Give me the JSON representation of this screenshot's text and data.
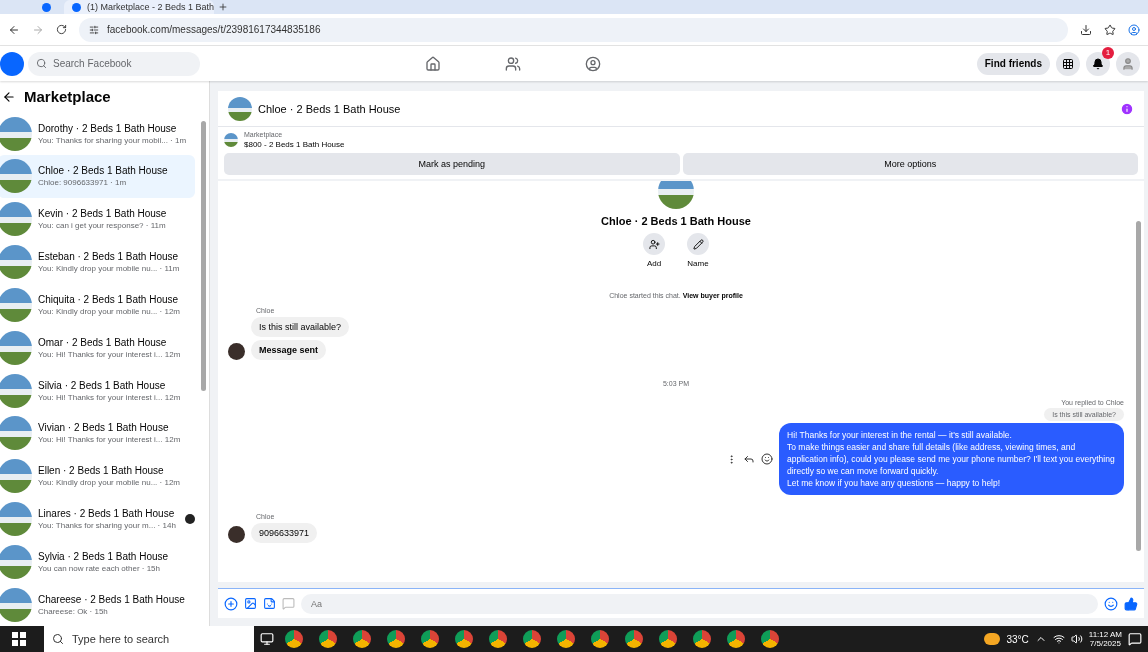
{
  "browser": {
    "tabs": [
      {
        "kind": "pinned",
        "selected": false
      },
      {
        "kind": "page",
        "title": "(1) Marketplace - 2 Beds 1 Bath",
        "selected": true
      }
    ],
    "url": "facebook.com/messages/t/23981617344835186"
  },
  "header": {
    "search_placeholder": "Search Facebook",
    "find_friends": "Find friends",
    "notification_count": "1"
  },
  "sidebar": {
    "title": "Marketplace",
    "conversations": [
      {
        "name": "Dorothy · 2 Beds 1 Bath House",
        "preview": "You: Thanks for sharing your mobil... · 1m",
        "selected": false,
        "seen": false
      },
      {
        "name": "Chloe · 2 Beds 1 Bath House",
        "preview": "Chloe: 9096633971 · 1m",
        "selected": true,
        "seen": false
      },
      {
        "name": "Kevin · 2 Beds 1 Bath House",
        "preview": "You: can i get your response? · 11m",
        "selected": false,
        "seen": false
      },
      {
        "name": "Esteban · 2 Beds 1 Bath House",
        "preview": "You: Kindly drop your mobile nu...  · 11m",
        "selected": false,
        "seen": false
      },
      {
        "name": "Chiquita · 2 Beds 1 Bath House",
        "preview": "You: Kindly drop your mobile nu...  · 12m",
        "selected": false,
        "seen": false
      },
      {
        "name": "Omar · 2 Beds 1 Bath House",
        "preview": "You: Hi! Thanks for your interest i...  12m",
        "selected": false,
        "seen": false
      },
      {
        "name": "Silvia · 2 Beds 1 Bath House",
        "preview": "You: Hi! Thanks for your interest i...  12m",
        "selected": false,
        "seen": false
      },
      {
        "name": "Vivian · 2 Beds 1 Bath House",
        "preview": "You: Hi! Thanks for your interest i...  12m",
        "selected": false,
        "seen": false
      },
      {
        "name": "Ellen · 2 Beds 1 Bath House",
        "preview": "You: Kindly drop your mobile nu...  · 12m",
        "selected": false,
        "seen": false
      },
      {
        "name": "Linares · 2 Beds 1 Bath House",
        "preview": "You: Thanks for sharing your m... · 14h",
        "selected": false,
        "seen": true
      },
      {
        "name": "Sylvia · 2 Beds 1 Bath House",
        "preview": "You can now rate each other · 15h",
        "selected": false,
        "seen": false
      },
      {
        "name": "Chareese · 2 Beds 1 Bath House",
        "preview": "Chareese: Ok · 15h",
        "selected": false,
        "seen": false
      }
    ]
  },
  "chat": {
    "title": "Chloe · 2 Beds 1 Bath House",
    "listing": {
      "label": "Marketplace",
      "summary": "$800 - 2 Beds 1 Bath House"
    },
    "buttons": [
      "Mark as pending",
      "More options"
    ],
    "profile": {
      "name": "Chloe · 2 Beds 1 Bath House",
      "actions": [
        {
          "kind": "add",
          "label": "Add"
        },
        {
          "kind": "edit",
          "label": "Name"
        }
      ]
    },
    "started": {
      "text": "Chloe started this chat.",
      "link": "View buyer profile"
    },
    "messages": [
      {
        "kind": "incoming",
        "sender": "Chloe",
        "bubbles": [
          {
            "text": "Is this still available?",
            "bold": false
          },
          {
            "text": "Message sent",
            "bold": true
          }
        ]
      },
      {
        "kind": "time",
        "text": "5:03 PM"
      },
      {
        "kind": "outgoing",
        "reply_note": "You replied to Chloe",
        "quoted": "Is this still available?",
        "text": "Hi! Thanks for your interest in the rental — it's still available.\nTo make things easier and share full details (like address, viewing times, and application info), could you please send me your phone number? I'll text you everything directly so we can move forward quickly.\nLet me know if you have any questions — happy to help!"
      },
      {
        "kind": "incoming",
        "sender": "Chloe",
        "bubbles": [
          {
            "text": "9096633971",
            "bold": false
          }
        ]
      }
    ],
    "composer_placeholder": "Aa"
  },
  "taskbar": {
    "search_placeholder": "Type here to search",
    "weather": "33°C",
    "time": "11:12 AM",
    "date": "7/5/2025"
  }
}
